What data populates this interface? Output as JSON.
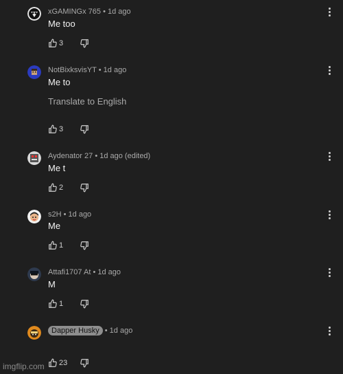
{
  "comments": [
    {
      "author": "xGAMINGx 765",
      "time": "• 1d ago",
      "text": "Me too",
      "likes": "3",
      "translate": ""
    },
    {
      "author": "NotBixksvisYT",
      "time": "• 1d ago",
      "text": "Me to",
      "likes": "3",
      "translate": "Translate to English"
    },
    {
      "author": "Aydenator 27",
      "time": "• 1d ago (edited)",
      "text": "Me t",
      "likes": "2",
      "translate": ""
    },
    {
      "author": "s2H",
      "time": "• 1d ago",
      "text": "Me",
      "likes": "1",
      "translate": ""
    },
    {
      "author": "Attafi1707 At",
      "time": "• 1d ago",
      "text": "M",
      "likes": "1",
      "translate": ""
    },
    {
      "author": "Dapper Husky",
      "time": "• 1d ago",
      "text": "",
      "likes": "23",
      "translate": ""
    }
  ],
  "watermark": "imgflip.com",
  "icons": {
    "like": "thumbs-up-icon",
    "dislike": "thumbs-down-icon",
    "menu": "more-vert-icon"
  }
}
